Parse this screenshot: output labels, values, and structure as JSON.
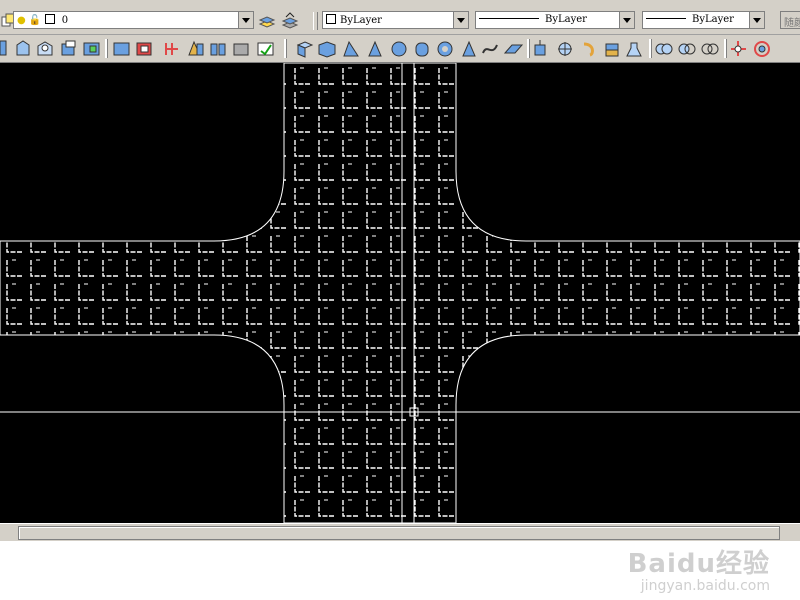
{
  "toolbar": {
    "layer": {
      "name": "0"
    },
    "color": {
      "value": "ByLayer"
    },
    "linetype": {
      "value": "ByLayer"
    },
    "lineweight": {
      "value": "ByLayer"
    },
    "plot_style": {
      "value": "随颜"
    }
  },
  "icons": {
    "row1": [
      "layer-state-icon",
      "layer-properties-icon",
      "make-object-layer-current-icon",
      "layer-previous-icon"
    ],
    "row2": [
      "3d-orbit-icon",
      "constrained-orbit-icon",
      "free-orbit-icon",
      "continuous-orbit-icon",
      "view-cube-icon",
      "view-ucs-icon",
      "ucs-origin-icon",
      "ucs-3point-icon",
      "ucs-object-icon",
      "ucs-apply-icon",
      "box-icon",
      "wedge-icon",
      "cone-icon",
      "sphere-icon",
      "cylinder-icon",
      "torus-icon",
      "pyramid-icon",
      "helix-icon",
      "planar-surface-icon",
      "extrude-icon",
      "press-pull-icon",
      "sweep-icon",
      "revolve-icon",
      "loft-icon",
      "union-icon",
      "subtract-icon",
      "intersect-icon",
      "3d-move-icon",
      "3d-rotate-icon"
    ]
  },
  "drawing": {
    "background": "#000000",
    "line_color": "#ffffff",
    "crosshair_color": "#ffffff"
  },
  "watermark": {
    "logo": "Baidu经验",
    "url": "jingyan.baidu.com"
  }
}
